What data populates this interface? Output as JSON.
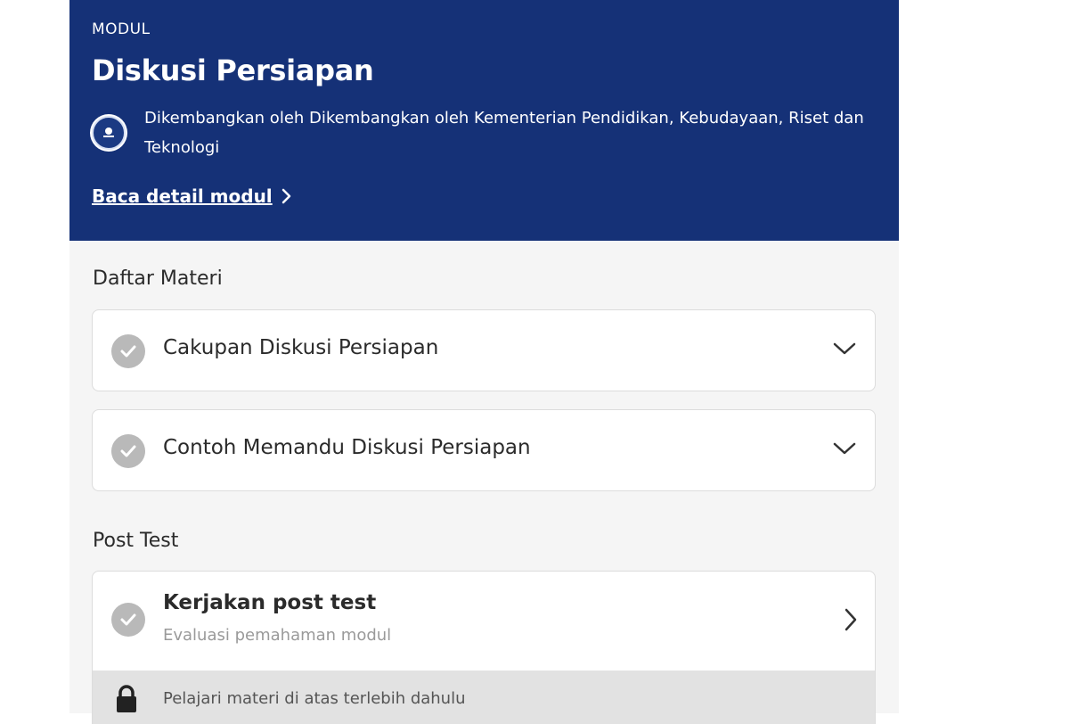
{
  "module": {
    "eyebrow": "MODUL",
    "title": "Diskusi Persiapan",
    "developer_text": "Dikembangkan oleh Dikembangkan oleh Kementerian Pendidikan, Kebudayaan, Riset dan Teknologi",
    "detail_link": "Baca detail modul"
  },
  "materials": {
    "section_title": "Daftar Materi",
    "items": [
      {
        "label": "Cakupan Diskusi Persiapan",
        "completed": true
      },
      {
        "label": "Contoh Memandu Diskusi Persiapan",
        "completed": true
      }
    ]
  },
  "post_test": {
    "section_title": "Post Test",
    "title": "Kerjakan post test",
    "subtitle": "Evaluasi pemahaman modul",
    "locked_message": "Pelajari materi di atas terlebih dahulu"
  },
  "colors": {
    "header_bg": "#153177",
    "panel_bg": "#f5f5f5",
    "check_gray": "#b9b9b9"
  }
}
